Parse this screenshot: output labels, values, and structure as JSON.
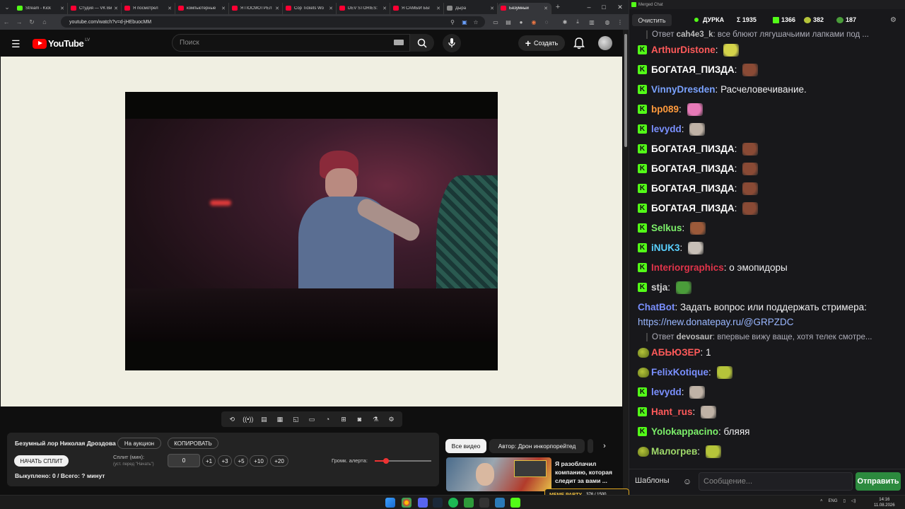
{
  "browser": {
    "tabs": [
      {
        "label": "Stream - Kick",
        "color": "#53fc18"
      },
      {
        "label": "Студия — VK Видео",
        "color": "#ff0033"
      },
      {
        "label": "Я посмотрел",
        "color": "#ff0033"
      },
      {
        "label": "компьютерные",
        "color": "#ff0033"
      },
      {
        "label": "Я ПОСМОТРЕЛ",
        "color": "#ff0033"
      },
      {
        "label": "Cop Tickets Wo",
        "color": "#ff0033"
      },
      {
        "label": "DEV STORIES:",
        "color": "#ff0033"
      },
      {
        "label": "Я САМЫЙ БЫ",
        "color": "#ff0033"
      },
      {
        "label": "Дыра",
        "color": "#8a8a8a"
      },
      {
        "label": "Безумный",
        "color": "#ff0033",
        "active": true
      }
    ],
    "url": "youtube.com/watch?v=d-jHEbuocMM"
  },
  "youtube": {
    "logo_text": "YouTube",
    "country": "LV",
    "search_placeholder": "Поиск",
    "create_label": "Создать"
  },
  "auction": {
    "title": "Безумный лор Николая Дроздова",
    "on_auction_label": "На аукцион",
    "copy_label": "КОПИРОВАТЬ",
    "start_label": "НАЧАТЬ СПЛИТ",
    "split_label": "Сплит (мин):",
    "split_hint": "(уст. перед \"Начать\")",
    "split_value": "0",
    "increments": [
      "+1",
      "+3",
      "+5",
      "+10",
      "+20"
    ],
    "alert_volume_label": "Громк. алерта:",
    "alert_volume": 0.2,
    "bought_label": "Выкуплено: 0 / Всего: ? минут"
  },
  "recommendations": {
    "chips": [
      "Все видео",
      "Автор: Дрон инкорпорейтед"
    ],
    "first_title": "Я разоблачил компанию, которая следит за вами ..."
  },
  "chat_app": {
    "window_title": "Merged Chat",
    "clear_label": "Очистить",
    "stream_name": "ДУРКА",
    "stats": {
      "total": "Σ 1935",
      "kick": "1366",
      "vk": "382",
      "other": "187"
    },
    "messages": [
      {
        "reply_to": "cah4e3_k",
        "reply_text": "все блюют лягушачьими лапками под ..."
      },
      {
        "user": "ArthurDistone",
        "color": "#ff5a5a",
        "text": "",
        "emote": "#d4d34a",
        "platform": "kick"
      },
      {
        "user": "БОГАТАЯ_ПИЗДА",
        "color": "#ffffff",
        "text": "",
        "emote": "#8a4a35",
        "platform": "kick"
      },
      {
        "user": "VinnyDresden",
        "color": "#7aa2ff",
        "text": "Расчеловечивание.",
        "platform": "kick"
      },
      {
        "user": "bp089",
        "color": "#ff9a3c",
        "text": "",
        "emote": "#e77ab8",
        "platform": "kick"
      },
      {
        "user": "levydd",
        "color": "#7a90ff",
        "text": "",
        "emote": "#bfb2a6",
        "platform": "kick"
      },
      {
        "user": "БОГАТАЯ_ПИЗДА",
        "color": "#ffffff",
        "text": "",
        "emote": "#8a4a35",
        "platform": "kick"
      },
      {
        "user": "БОГАТАЯ_ПИЗДА",
        "color": "#ffffff",
        "text": "",
        "emote": "#8a4a35",
        "platform": "kick"
      },
      {
        "user": "БОГАТАЯ_ПИЗДА",
        "color": "#ffffff",
        "text": "",
        "emote": "#8a4a35",
        "platform": "kick"
      },
      {
        "user": "БОГАТАЯ_ПИЗДА",
        "color": "#ffffff",
        "text": "",
        "emote": "#8a4a35",
        "platform": "kick"
      },
      {
        "user": "Selkus",
        "color": "#7cf06a",
        "text": "",
        "emote": "#9c5a3a",
        "platform": "kick"
      },
      {
        "user": "iNUK3",
        "color": "#5ad1ff",
        "text": "",
        "emote": "#c8c0b8",
        "platform": "kick"
      },
      {
        "user": "Interiorgraphics",
        "color": "#e0344a",
        "text": "о эмопидоры",
        "platform": "kick"
      },
      {
        "user": "stja",
        "color": "#d0d0d0",
        "text": "",
        "emote": "#4a9c3a",
        "platform": "kick"
      },
      {
        "user": "ChatBot",
        "color": "#7a90ff",
        "text": "Задать вопрос или поддержать стримера:",
        "link": "https://new.donatepay.ru/@GRPZDC",
        "platform": "vk"
      },
      {
        "reply_to": "devosaur",
        "reply_text": "впервые вижу ваще, хотя телек смотре..."
      },
      {
        "user": "АБЬЮЗЕР",
        "color": "#ff5a5a",
        "text": "1",
        "platform": "vk"
      },
      {
        "user": "FelixKotique",
        "color": "#7a90ff",
        "text": "",
        "emote": "#b5c43a",
        "platform": "vk"
      },
      {
        "user": "levydd",
        "color": "#7a90ff",
        "text": "",
        "emote": "#bfb2a6",
        "platform": "kick"
      },
      {
        "user": "Hant_rus",
        "color": "#ff5a5a",
        "text": "",
        "emote": "#bfb2a6",
        "platform": "kick"
      },
      {
        "user": "Yolokappacino",
        "color": "#7cf06a",
        "text": "бляяя",
        "platform": "kick"
      },
      {
        "user": "Малогрев",
        "color": "#9fd96a",
        "text": "",
        "emote": "#b5c43a",
        "platform": "vk"
      }
    ],
    "input_placeholder": "Сообщение...",
    "templates_label": "Шаблоны",
    "send_label": "Отправить"
  },
  "overlay": {
    "meme_label": "MEME PARTY",
    "meme_progress": "376 / 1500"
  },
  "taskbar": {
    "lang": "ENG",
    "time": "14:16",
    "date": "11.08.2026"
  }
}
